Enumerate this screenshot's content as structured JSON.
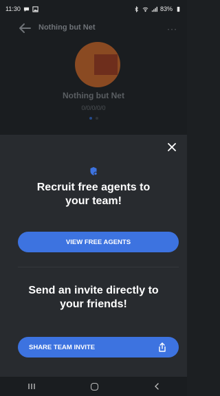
{
  "status_bar": {
    "time": "11:30",
    "battery": "83%"
  },
  "header": {
    "title": "Nothing but Net",
    "more_label": "···",
    "team_name": "Nothing but Net",
    "record": "0/0/0/0/0"
  },
  "sheet": {
    "recruit_title": "Recruit free agents to your team!",
    "view_free_agents_label": "VIEW FREE AGENTS",
    "invite_title": "Send an invite directly to your friends!",
    "share_invite_label": "SHARE TEAM INVITE"
  },
  "colors": {
    "accent": "#3d73e0",
    "sheet_bg": "#282b2f",
    "page_bg": "#1a1d20"
  },
  "icons": [
    "back-arrow-icon",
    "more-icon",
    "close-icon",
    "shield-icon",
    "share-icon",
    "recents-icon",
    "home-icon",
    "nav-back-icon"
  ]
}
